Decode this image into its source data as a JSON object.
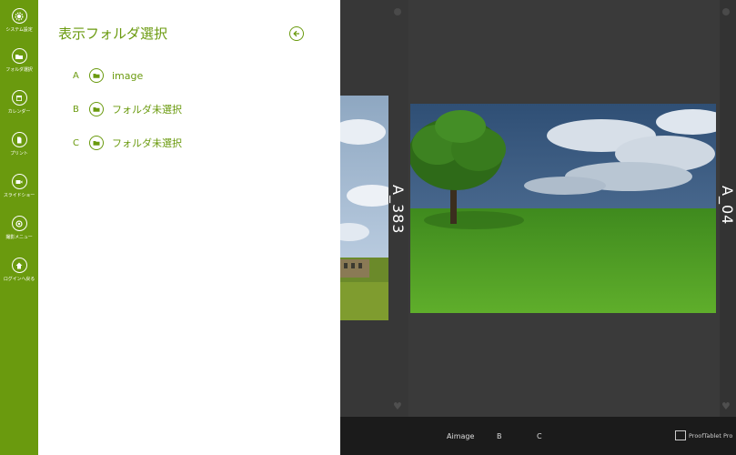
{
  "appbar": {
    "items": [
      {
        "label": "システム設定",
        "icon": "gear-icon"
      },
      {
        "label": "フォルダ選択",
        "icon": "folder-icon"
      },
      {
        "label": "カレンダー",
        "icon": "calendar-icon"
      },
      {
        "label": "プリント",
        "icon": "document-icon"
      },
      {
        "label": "スライドショー",
        "icon": "video-icon"
      },
      {
        "label": "撮影メニュー",
        "icon": "camera-icon"
      },
      {
        "label": "ログインへ戻る",
        "icon": "home-icon"
      }
    ]
  },
  "panel": {
    "title": "表示フォルダ選択",
    "folders": [
      {
        "letter": "A",
        "name": "image"
      },
      {
        "letter": "B",
        "name": "フォルダ未選択"
      },
      {
        "letter": "C",
        "name": "フォルダ未選択"
      }
    ]
  },
  "viewer": {
    "left_label": "A_383",
    "right_label": "A_04"
  },
  "bottombar": {
    "tabs": [
      "Aimage",
      "B",
      "C"
    ],
    "brand": "ProofTablet Pro"
  },
  "colors": {
    "accent": "#6a9a0e",
    "bar": "#1b1b1b",
    "panel": "#ffffff"
  }
}
